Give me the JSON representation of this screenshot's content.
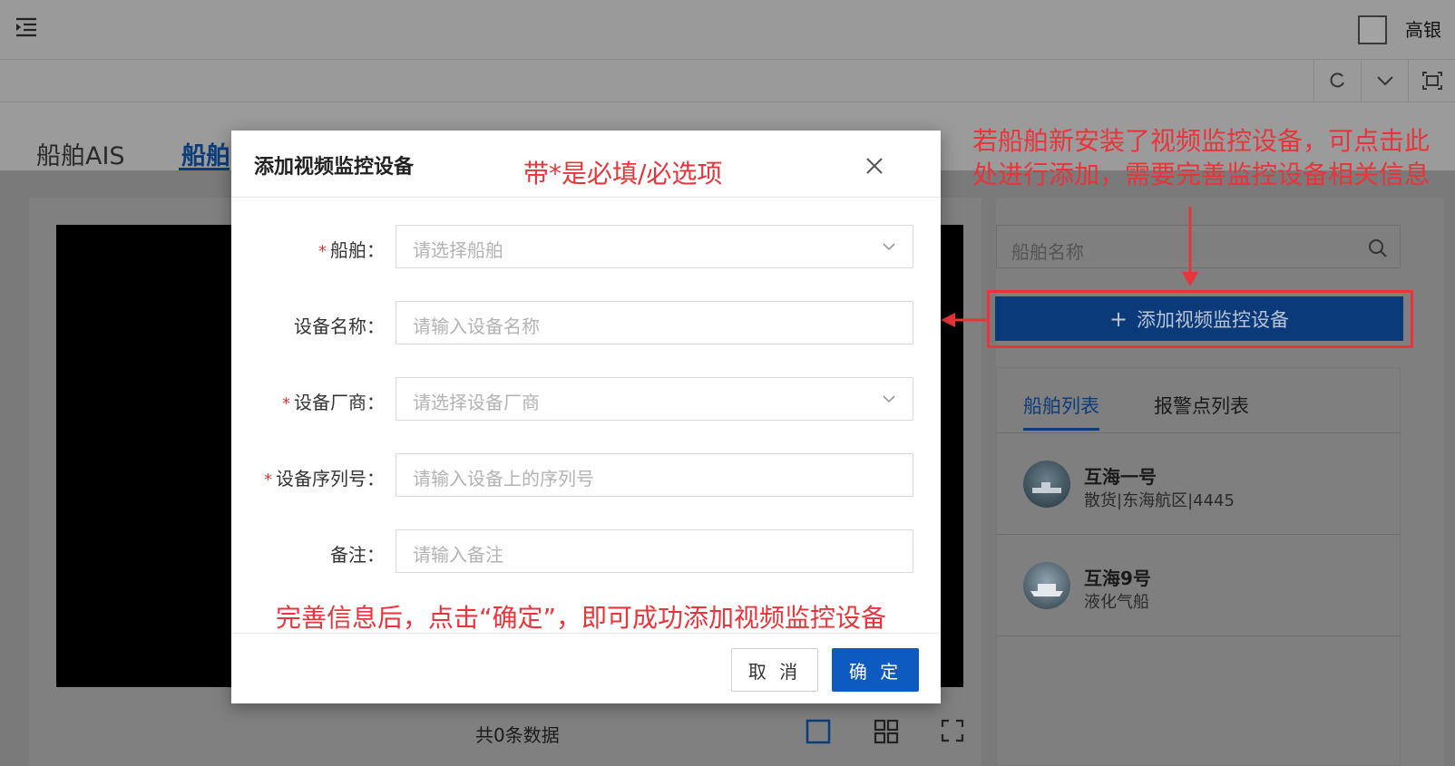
{
  "header": {
    "user_name": "高银"
  },
  "tabs": {
    "ais": "船舶AIS",
    "ship": "船舶"
  },
  "video": {
    "count_text": "共0条数据"
  },
  "sidebar": {
    "search_placeholder": "船舶名称",
    "add_button_label": "添加视频监控设备",
    "list_tabs": [
      "船舶列表",
      "报警点列表"
    ],
    "ships": [
      {
        "name": "互海一号",
        "sub": "散货|东海航区|4445"
      },
      {
        "name": "互海9号",
        "sub": "液化气船"
      }
    ]
  },
  "modal": {
    "title": "添加视频监控设备",
    "fields": [
      {
        "label": "船舶：",
        "required": true,
        "placeholder": "请选择船舶",
        "type": "select"
      },
      {
        "label": "设备名称：",
        "required": false,
        "placeholder": "请输入设备名称",
        "type": "input"
      },
      {
        "label": "设备厂商：",
        "required": true,
        "placeholder": "请选择设备厂商",
        "type": "select"
      },
      {
        "label": "设备序列号：",
        "required": true,
        "placeholder": "请输入设备上的序列号",
        "type": "input"
      },
      {
        "label": "备注：",
        "required": false,
        "placeholder": "请输入备注",
        "type": "input"
      }
    ],
    "cancel_label": "取 消",
    "ok_label": "确 定"
  },
  "annotations": {
    "top_right": "若船舶新安装了视频监控设备，可点击此处进行添加，需要完善监控设备相关信息",
    "required_note": "带*是必填/必选项",
    "bottom_note": "完善信息后，点击“确定”，即可成功添加视频监控设备"
  },
  "colors": {
    "annotation": "#e8343a",
    "brand": "#0a3a7a",
    "primary": "#0d5bc1"
  }
}
